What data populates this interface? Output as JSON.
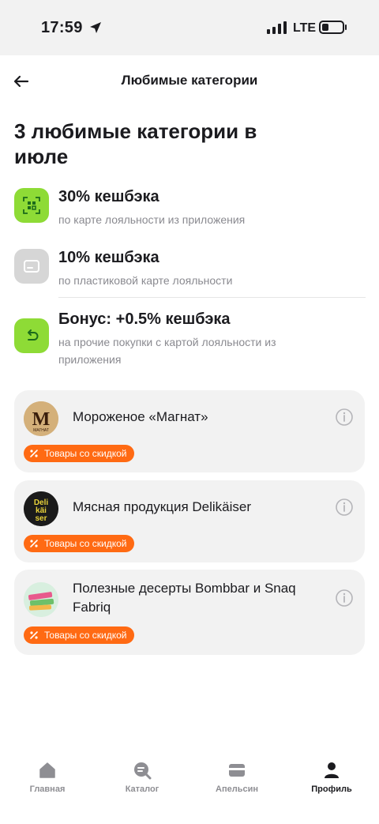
{
  "status_bar": {
    "time": "17:59",
    "network": "LTE"
  },
  "header": {
    "title": "Любимые категории"
  },
  "page_title": "3 любимые категории в июле",
  "tiers": [
    {
      "title": "30% кешбэка",
      "description": "по карте лояльности из приложения",
      "icon": "qr-code-icon",
      "color": "#8edb36"
    },
    {
      "title": "10% кешбэка",
      "description": "по пластиковой карте лояльности",
      "icon": "card-icon",
      "color": "#d6d6d6"
    },
    {
      "title": "Бонус: +0.5% кешбэка",
      "description": "на прочие покупки с картой лояльности из приложения",
      "icon": "return-arrow-icon",
      "color": "#8edb36"
    }
  ],
  "categories": [
    {
      "name": "Мороженое «Магнат»",
      "logo_text": "МАГНАТ",
      "badge": "Товары со скидкой"
    },
    {
      "name": "Мясная продукция Delikäiser",
      "logo_text": "Deli käi ser",
      "badge": "Товары со скидкой"
    },
    {
      "name": "Полезные десерты Bombbar и Snaq Fabriq",
      "badge": "Товары со скидкой"
    }
  ],
  "tabbar": [
    {
      "label": "Главная",
      "icon": "home-icon",
      "active": false
    },
    {
      "label": "Каталог",
      "icon": "catalog-icon",
      "active": false
    },
    {
      "label": "Апельсин",
      "icon": "card-icon",
      "active": false
    },
    {
      "label": "Профиль",
      "icon": "profile-icon",
      "active": true
    }
  ],
  "colors": {
    "accent": "#ff6a13",
    "green": "#8edb36",
    "card_bg": "#f2f2f2"
  }
}
